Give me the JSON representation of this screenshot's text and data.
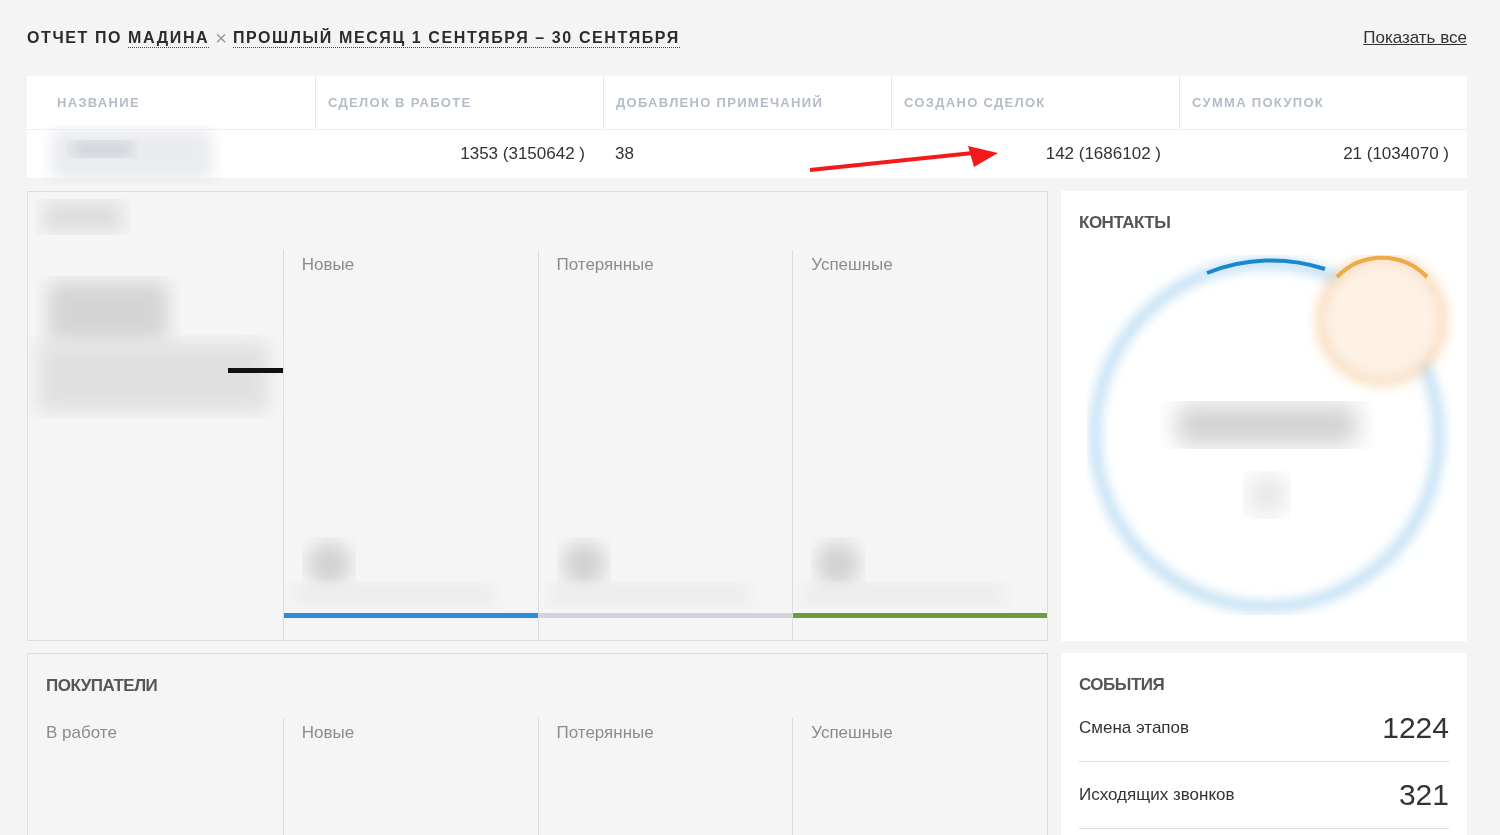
{
  "report": {
    "prefix": "ОТЧЕТ ПО",
    "user": "МАДИНА",
    "remove": "×",
    "period": "ПРОШЛЫЙ МЕСЯЦ 1 СЕНТЯБРЯ – 30 СЕНТЯБРЯ",
    "show_all": "Показать все"
  },
  "table": {
    "columns": [
      "НАЗВАНИЕ",
      "СДЕЛОК В РАБОТЕ",
      "ДОБАВЛЕНО ПРИМЕЧАНИЙ",
      "СОЗДАНО СДЕЛОК",
      "СУММА ПОКУПОК"
    ],
    "rows": [
      {
        "values": [
          "1353 (3150642 )",
          "38",
          "142 (1686102 )",
          "21 (1034070 )"
        ]
      }
    ]
  },
  "deals": {
    "columns": [
      {
        "label": "Новые",
        "color": "#2a8fd8"
      },
      {
        "label": "Потерянные",
        "color": "#cfd4da"
      },
      {
        "label": "Успешные",
        "color": "#6f9b3c"
      }
    ]
  },
  "contacts": {
    "title": "КОНТАКТЫ"
  },
  "buyers": {
    "title": "ПОКУПАТЕЛИ",
    "columns": [
      "В работе",
      "Новые",
      "Потерянные",
      "Успешные"
    ]
  },
  "events": {
    "title": "СОБЫТИЯ",
    "rows": [
      {
        "label": "Смена этапов",
        "value": "1224"
      },
      {
        "label": "Исходящих звонков",
        "value": "321"
      }
    ]
  }
}
